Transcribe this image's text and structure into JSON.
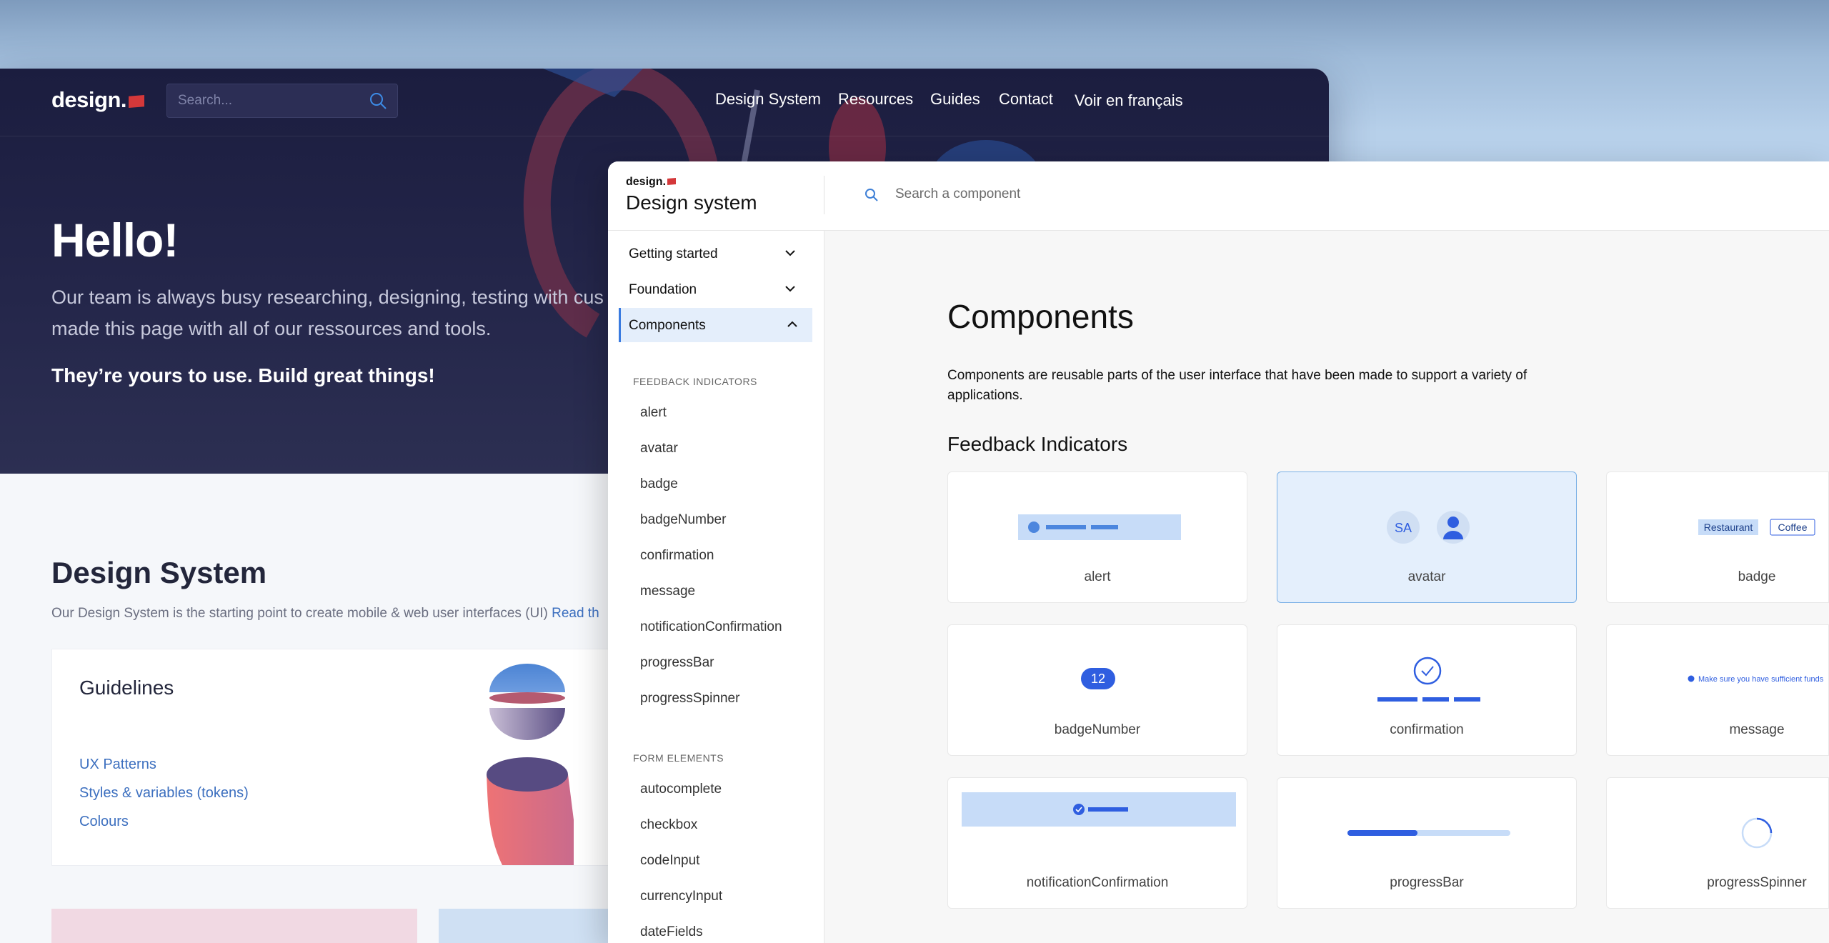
{
  "site": {
    "logo": "design.",
    "search_placeholder": "Search...",
    "nav": [
      "Design System",
      "Resources",
      "Guides",
      "Contact",
      "Voir en français"
    ],
    "hero_title": "Hello!",
    "hero_text": "Our team is always busy researching, designing, testing with cus we made this page with all of our ressources and tools.",
    "hero_tagline": "They’re yours to use. Build great things!",
    "ds_title": "Design System",
    "ds_text": "Our Design System is the starting point to create mobile & web user interfaces (UI)",
    "ds_link": "Read th",
    "guidelines": {
      "title": "Guidelines",
      "links": [
        "UX Patterns",
        "Styles & variables (tokens)",
        "Colours"
      ]
    }
  },
  "ds_app": {
    "logo": "design.",
    "title": "Design system",
    "search_placeholder": "Search a component",
    "sections": [
      "Getting started",
      "Foundation",
      "Components"
    ],
    "groups": [
      {
        "label": "FEEDBACK INDICATORS",
        "items": [
          "alert",
          "avatar",
          "badge",
          "badgeNumber",
          "confirmation",
          "message",
          "notificationConfirmation",
          "progressBar",
          "progressSpinner"
        ]
      },
      {
        "label": "FORM ELEMENTS",
        "items": [
          "autocomplete",
          "checkbox",
          "codeInput",
          "currencyInput",
          "dateFields"
        ]
      }
    ],
    "heading": "Components",
    "description": "Components are reusable parts of the user interface that have been made to support a variety of applications.",
    "subheading": "Feedback Indicators",
    "tiles": [
      "alert",
      "avatar",
      "badge",
      "badgeNumber",
      "confirmation",
      "message",
      "notificationConfirmation",
      "progressBar",
      "progressSpinner"
    ],
    "previews": {
      "avatar_initials": "SA",
      "badge_1": "Restaurant",
      "badge_2": "Coffee",
      "badge_number": "12",
      "message_text": "Make sure you have sufficient funds",
      "progress_fraction": 0.43
    },
    "colors": {
      "accent": "#2f5ee0",
      "selected_bg": "#e4effc"
    }
  }
}
